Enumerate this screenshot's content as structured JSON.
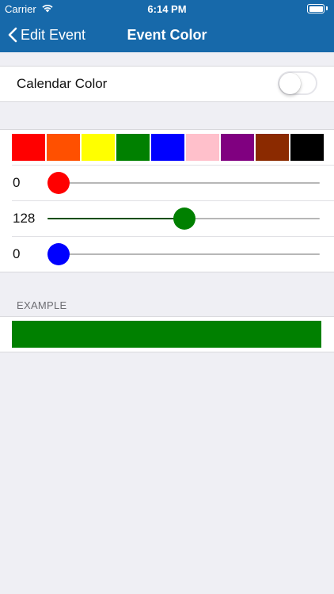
{
  "status_bar": {
    "carrier": "Carrier",
    "time": "6:14 PM"
  },
  "nav": {
    "back_label": "Edit Event",
    "title": "Event Color"
  },
  "calendar_color": {
    "label": "Calendar Color",
    "enabled": false
  },
  "palette": [
    {
      "name": "red",
      "color": "#ff0000"
    },
    {
      "name": "orange",
      "color": "#ff5000"
    },
    {
      "name": "yellow",
      "color": "#ffff00"
    },
    {
      "name": "green",
      "color": "#008000"
    },
    {
      "name": "blue",
      "color": "#0000ff"
    },
    {
      "name": "pink",
      "color": "#ffc0cb"
    },
    {
      "name": "purple",
      "color": "#800080"
    },
    {
      "name": "brown",
      "color": "#8b2a00"
    },
    {
      "name": "black",
      "color": "#000000"
    }
  ],
  "sliders": {
    "red": {
      "value": "0",
      "fraction": 0.0,
      "thumb_color": "#ff0000",
      "fill_color": "#ff0000"
    },
    "green": {
      "value": "128",
      "fraction": 0.502,
      "thumb_color": "#008000",
      "fill_color": "#004d00"
    },
    "blue": {
      "value": "0",
      "fraction": 0.0,
      "thumb_color": "#0000ff",
      "fill_color": "#0000ff"
    }
  },
  "example": {
    "header": "EXAMPLE",
    "color": "#008000"
  },
  "theme": {
    "nav_color": "#1769aa",
    "background": "#efeff4"
  }
}
